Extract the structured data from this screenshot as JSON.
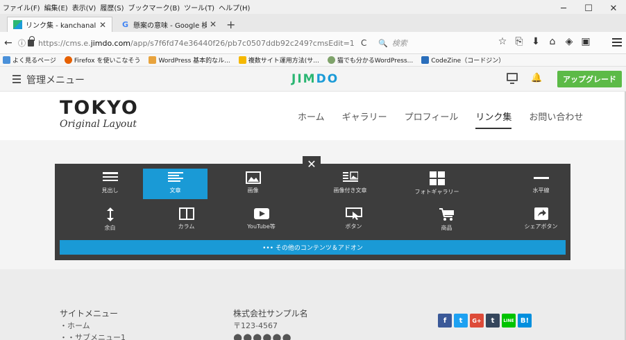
{
  "menubar": {
    "items": [
      "ファイル(F)",
      "編集(E)",
      "表示(V)",
      "履歴(S)",
      "ブックマーク(B)",
      "ツール(T)",
      "ヘルプ(H)"
    ],
    "minimize": "─",
    "maximize": "☐",
    "close": "✕"
  },
  "tabs": [
    {
      "title": "リンク集 - kanchanalbumsite",
      "close": "✕",
      "icon": "jimdo-favicon"
    },
    {
      "title": "懸案の意味 - Google 検索",
      "close": "✕",
      "icon": "google-favicon"
    }
  ],
  "newtab": "+",
  "nav": {
    "back": "←",
    "info": "ⓘ",
    "url_prefix": "https://cms.e.",
    "url_domain": "jimdo.com",
    "url_path": "/app/s7f6fd74e36440f26/pb7c0507ddb92c249?cmsEdit=1",
    "reload": "C",
    "search_icon": "🔍",
    "search_placeholder": "検索",
    "toolbar_icons": [
      "☆",
      "⎘",
      "⬇",
      "⌂",
      "◈",
      "▣"
    ]
  },
  "bookmarks": [
    {
      "label": "よく見るページ",
      "color": "#4a90d9"
    },
    {
      "label": "Firefox を使いこなそう",
      "color": "#e66000"
    },
    {
      "label": "WordPress 基本的なル...",
      "color": "#e8a33d"
    },
    {
      "label": "複数サイト運用方法(サ...",
      "color": "#f5b800"
    },
    {
      "label": "猫でも分かるWordPress...",
      "color": "#7fa36b"
    },
    {
      "label": "CodeZine（コードジン）",
      "color": "#2a6ebb"
    }
  ],
  "admin": {
    "menu_label": "管理メニュー",
    "logo_left": "JIM",
    "logo_right": "DO",
    "upgrade": "アップグレード"
  },
  "site": {
    "logo_main": "TOKYO",
    "logo_sub": "Original Layout",
    "nav": [
      "ホーム",
      "ギャラリー",
      "プロフィール",
      "リンク集",
      "お問い合わせ"
    ],
    "nav_current": "リンク集"
  },
  "panel": {
    "close": "✕",
    "items_row1": [
      "見出し",
      "文章",
      "画像",
      "画像付き文章",
      "フォトギャラリー",
      "水平線"
    ],
    "items_row2": [
      "余白",
      "カラム",
      "YouTube等",
      "ボタン",
      "商品",
      "シェアボタン"
    ],
    "selected": "文章",
    "more": "••• その他のコンテンツ＆アドオン"
  },
  "footer": {
    "col1_title": "サイトメニュー",
    "col1_items": [
      "・ホーム",
      "・・サブメニュー1"
    ],
    "col2_title": "株式会社サンプル名",
    "col2_zip": "〒123-4567",
    "col2_dots": "●●●●●●",
    "socials": [
      {
        "label": "f",
        "color": "#3b5998"
      },
      {
        "label": "t",
        "color": "#1da1f2"
      },
      {
        "label": "G+",
        "color": "#dd4b39"
      },
      {
        "label": "t",
        "color": "#35465c"
      },
      {
        "label": "LINE",
        "color": "#00c300"
      },
      {
        "label": "B!",
        "color": "#008fde"
      }
    ]
  }
}
